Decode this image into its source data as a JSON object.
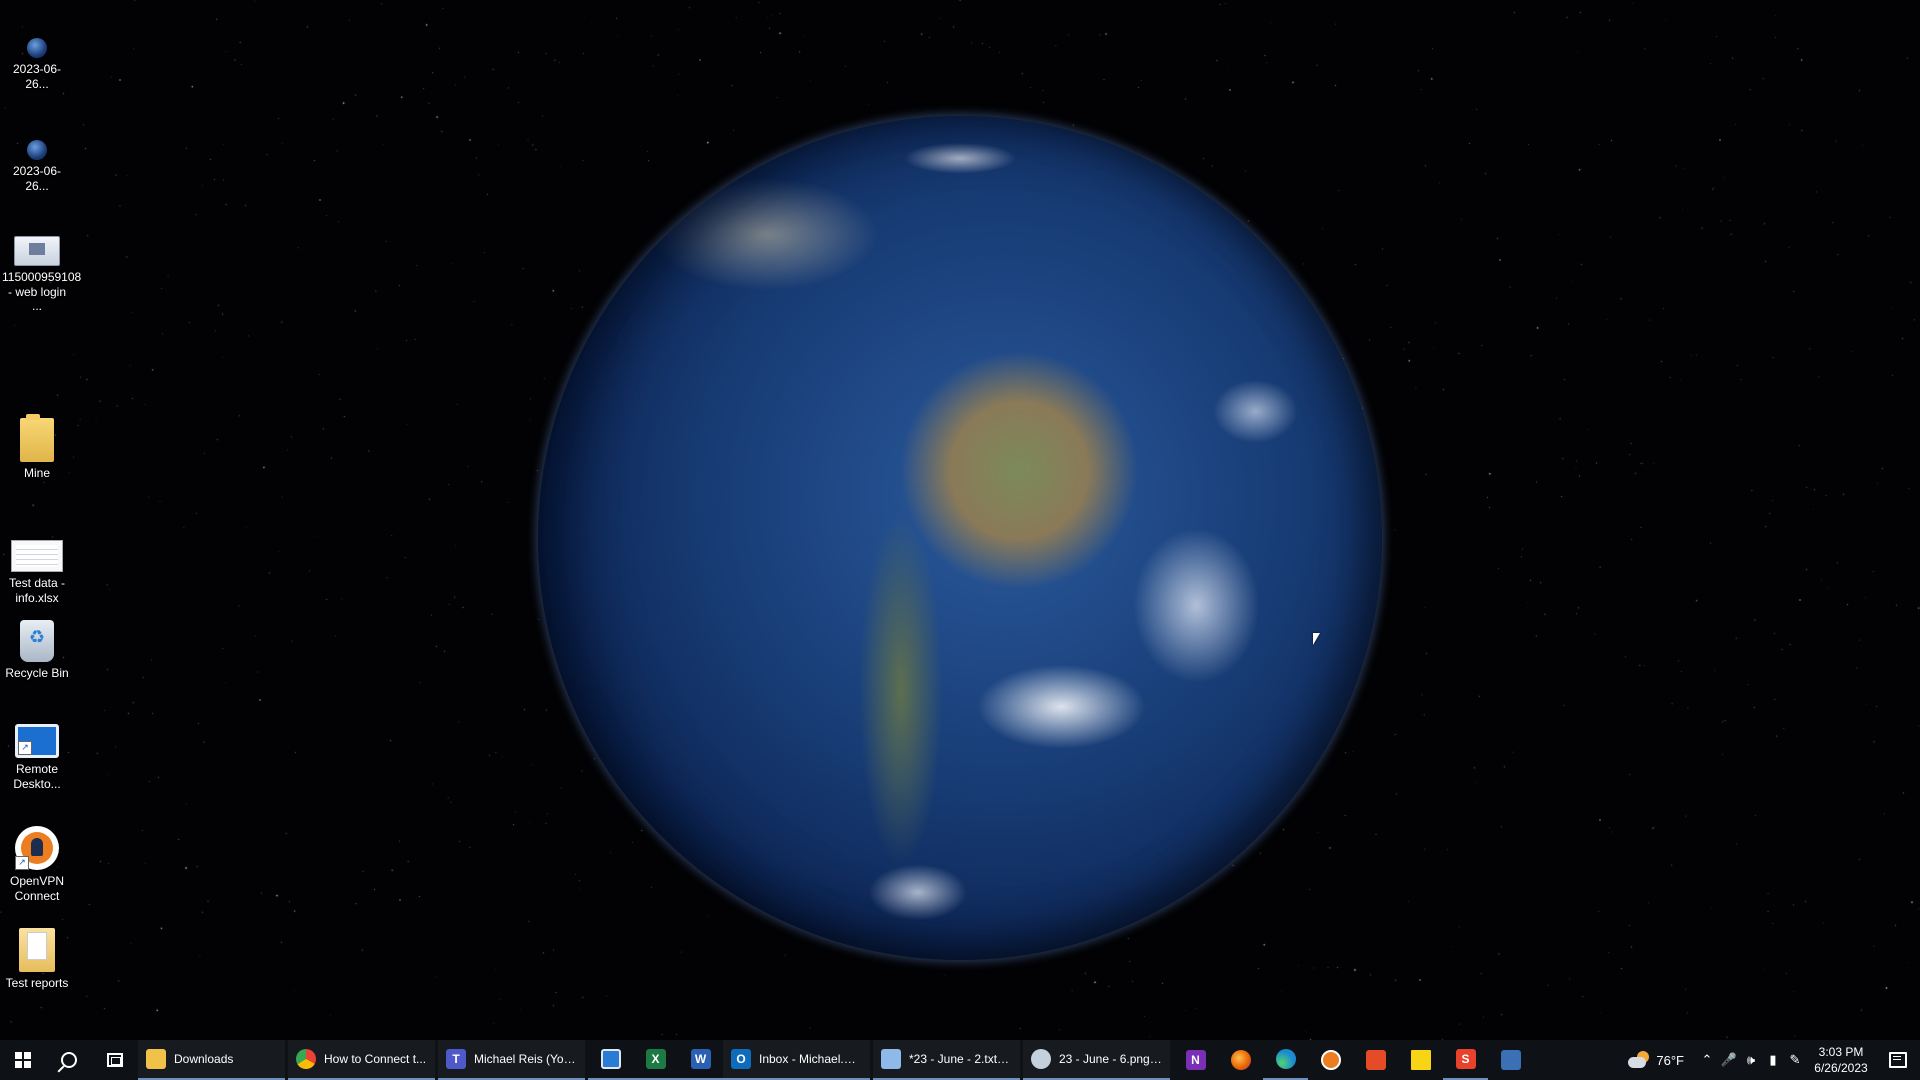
{
  "desktop": {
    "icons": [
      {
        "name": "2023-06-26...",
        "kind": "image-file"
      },
      {
        "name": "2023-06-26...",
        "kind": "image-file"
      },
      {
        "name": "115000959108 - web login ...",
        "kind": "screenshot-file"
      },
      {
        "name": "Mine",
        "kind": "folder"
      },
      {
        "name": "Test data - info.xlsx",
        "kind": "excel-file"
      },
      {
        "name": "Recycle Bin",
        "kind": "recycle-bin"
      },
      {
        "name": "Remote Deskto...",
        "kind": "remote-desktop-shortcut"
      },
      {
        "name": "OpenVPN Connect",
        "kind": "openvpn-shortcut"
      },
      {
        "name": "Test reports",
        "kind": "folder"
      }
    ]
  },
  "taskbar": {
    "apps": [
      {
        "label": "Downloads",
        "icon": "file-explorer-icon",
        "color": "#f0c24a"
      },
      {
        "label": "How to Connect t...",
        "icon": "chrome-icon",
        "color": "#34a853"
      },
      {
        "label": "Michael Reis (You) ...",
        "icon": "teams-icon",
        "color": "#5059c9"
      },
      {
        "label": "Inbox - Michael.Re...",
        "icon": "outlook-icon",
        "color": "#0f6cbd"
      },
      {
        "label": "*23 - June - 2.txt - ...",
        "icon": "notepad-icon",
        "color": "#8fb9e8"
      },
      {
        "label": "23 - June - 6.png - ...",
        "icon": "paint-icon",
        "color": "#c4d0dc"
      }
    ],
    "pinned_mid": [
      {
        "icon": "remote-desktop-icon",
        "color": "#2a7bd4"
      },
      {
        "icon": "excel-icon",
        "color": "#1d7a45",
        "letter": "X"
      },
      {
        "icon": "word-icon",
        "color": "#2b5fb4",
        "letter": "W"
      }
    ],
    "pinned_end": [
      {
        "icon": "onenote-icon",
        "color": "#7b2fb5",
        "letter": "N"
      },
      {
        "icon": "firefox-icon",
        "color": "#e66000"
      },
      {
        "icon": "edge-icon",
        "color": "#1a8ad4"
      },
      {
        "icon": "openvpn-icon",
        "color": "#ea7e20"
      },
      {
        "icon": "office-icon",
        "color": "#e34c26"
      },
      {
        "icon": "sticky-notes-icon",
        "color": "#f7d416"
      },
      {
        "icon": "snagit-icon",
        "color": "#e8412c",
        "letter": "S"
      },
      {
        "icon": "network-tool-icon",
        "color": "#3b6fb6"
      }
    ],
    "weather": {
      "temp": "76°F"
    },
    "tray_icons": [
      "chevron-up-icon",
      "microphone-icon",
      "speaker-icon",
      "battery-icon",
      "pen-icon"
    ],
    "clock": {
      "time": "3:03 PM",
      "date": "6/26/2023"
    }
  }
}
